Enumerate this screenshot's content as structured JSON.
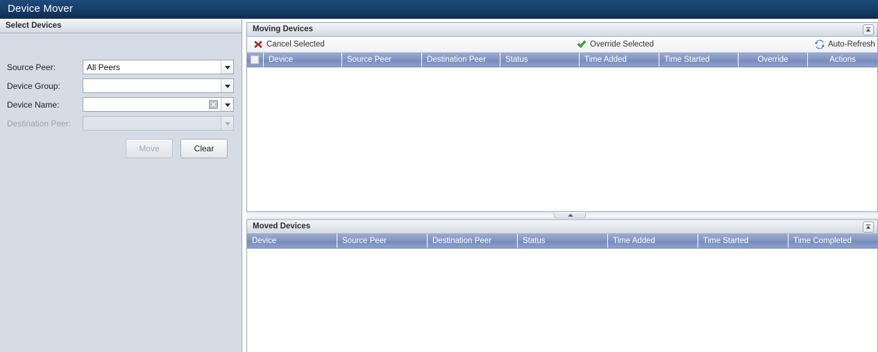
{
  "window": {
    "title": "Device Mover"
  },
  "left_panel": {
    "header_title": "Select Devices",
    "fields": [
      {
        "label": "Source Peer:",
        "value": "All Peers",
        "placeholder": "",
        "disabled": false,
        "clearable": false,
        "icon": "chevron-down-icon"
      },
      {
        "label": "Device Group:",
        "value": "",
        "placeholder": "",
        "disabled": false,
        "clearable": false,
        "icon": "chevron-down-icon"
      },
      {
        "label": "Device Name:",
        "value": "",
        "placeholder": "",
        "disabled": false,
        "clearable": true,
        "icon": "chevron-down-icon"
      },
      {
        "label": "Destination Peer:",
        "value": "",
        "placeholder": "",
        "disabled": true,
        "clearable": false,
        "icon": "chevron-down-icon"
      }
    ],
    "buttons": {
      "move": "Move",
      "clear": "Clear"
    }
  },
  "moving_devices": {
    "header_title": "Moving Devices",
    "collapse_icon": "collapse-up-icon",
    "toolbar": {
      "cancel_selected": "Cancel Selected",
      "cancel_icon": "red-x-icon",
      "override_selected": "Override Selected",
      "override_icon": "green-check-icon",
      "auto_refresh": "Auto-Refresh",
      "auto_refresh_icon": "refresh-icon"
    },
    "columns": [
      "Device",
      "Source Peer",
      "Destination Peer",
      "Status",
      "Time Added",
      "Time Started",
      "Override",
      "Actions"
    ],
    "rows": []
  },
  "moved_devices": {
    "header_title": "Moved Devices",
    "collapse_icon": "collapse-up-icon",
    "columns": [
      "Device",
      "Source Peer",
      "Destination Peer",
      "Status",
      "Time Added",
      "Time Started",
      "Time Completed"
    ],
    "rows": []
  },
  "colors": {
    "titlebar_dark": "#0f2e52",
    "titlebar_light": "#1e4a7a",
    "grid_header_blue": "#8296c4",
    "panel_bg": "#d6dce5",
    "danger": "#cc2222",
    "success": "#3aa83a",
    "accent": "#3b6fb5"
  }
}
